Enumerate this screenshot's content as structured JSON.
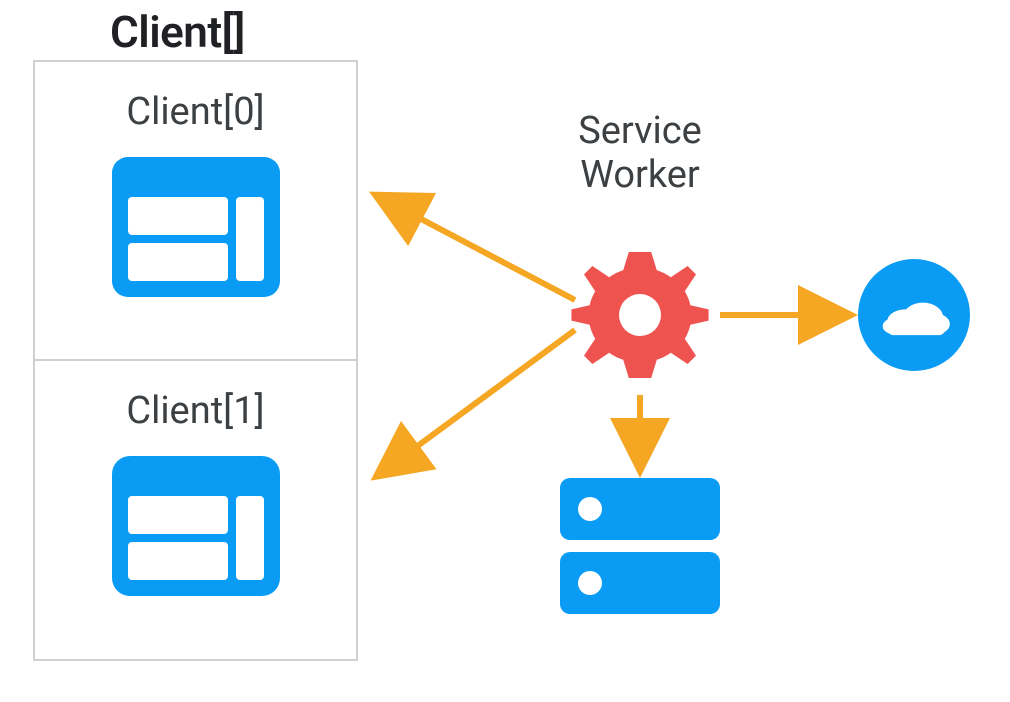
{
  "title": "Client[]",
  "clients": [
    {
      "label": "Client[0]"
    },
    {
      "label": "Client[1]"
    }
  ],
  "serviceWorker": {
    "label_line1": "Service",
    "label_line2": "Worker"
  },
  "colors": {
    "blue": "#0a9cf5",
    "red": "#ef5350",
    "orange": "#f5a623",
    "border": "#d0d0d0",
    "text": "#3c4043"
  }
}
